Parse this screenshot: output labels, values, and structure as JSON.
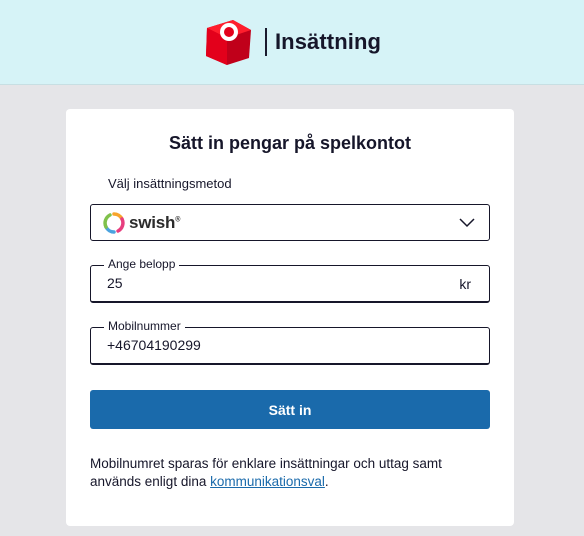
{
  "header": {
    "title": "Insättning",
    "logo_icon": "svenska-spel-logo-icon",
    "logo_color": "#e3001b",
    "background": "#d6f3f7"
  },
  "form": {
    "title": "Sätt in pengar på spelkontot",
    "method": {
      "label": "Välj insättningsmetod",
      "selected": "swish",
      "selected_icon": "swish-logo-icon",
      "dropdown_icon": "chevron-down-icon"
    },
    "amount": {
      "label": "Ange belopp",
      "value": "25",
      "suffix": "kr"
    },
    "phone": {
      "label": "Mobilnummer",
      "value": "+46704190299"
    },
    "submit_label": "Sätt in",
    "submit_color": "#1a6aab",
    "note_text": "Mobilnumret sparas för enklare insättningar och uttag samt används enligt dina ",
    "note_link": "kommunikationsval",
    "note_end": "."
  }
}
